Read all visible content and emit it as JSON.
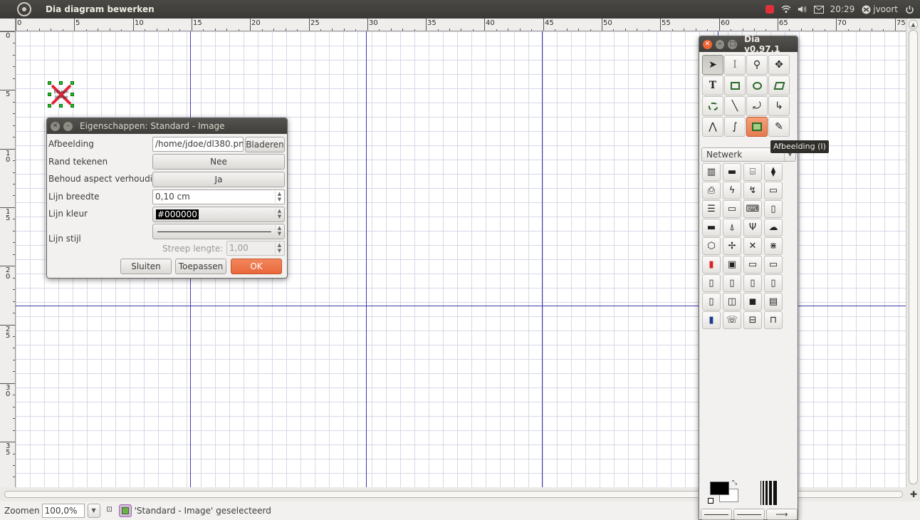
{
  "window": {
    "title": "Dia diagram bewerken"
  },
  "panel": {
    "time": "20:29",
    "user": "jvoort"
  },
  "ruler": {
    "top": [
      "0",
      "5",
      "10",
      "15",
      "20",
      "25",
      "30",
      "35",
      "40",
      "45",
      "50",
      "55",
      "60",
      "65",
      "70",
      "75"
    ],
    "left": [
      "0",
      "5",
      "1\n0",
      "1\n5",
      "2\n0",
      "2\n5",
      "3\n0",
      "3\n5"
    ]
  },
  "canvas": {
    "image_placeholder_text": "broken image"
  },
  "props": {
    "title": "Eigenschappen: Standard - Image",
    "afbeelding_label": "Afbeelding",
    "afbeelding_value": "/home/jdoe/dl380.png",
    "browse_label": "Bladeren",
    "rand_label": "Rand tekenen",
    "rand_value": "Nee",
    "aspect_label": "Behoud aspect verhouding",
    "aspect_value": "Ja",
    "breedte_label": "Lijn breedte",
    "breedte_value": "0,10 cm",
    "kleur_label": "Lijn kleur",
    "kleur_value": "#000000",
    "stijl_label": "Lijn stijl",
    "streep_label": "Streep lengte:",
    "streep_value": "1,00",
    "close_label": "Sluiten",
    "apply_label": "Toepassen",
    "ok_label": "OK"
  },
  "toolbox": {
    "title": "Dia v0.97.1",
    "sheet": "Netwerk",
    "tooltip": "Afbeelding (I)"
  },
  "status": {
    "zoom_label": "Zoomen",
    "zoom_value": "100,0%",
    "selection": "'Standard - Image' geselecteerd"
  }
}
